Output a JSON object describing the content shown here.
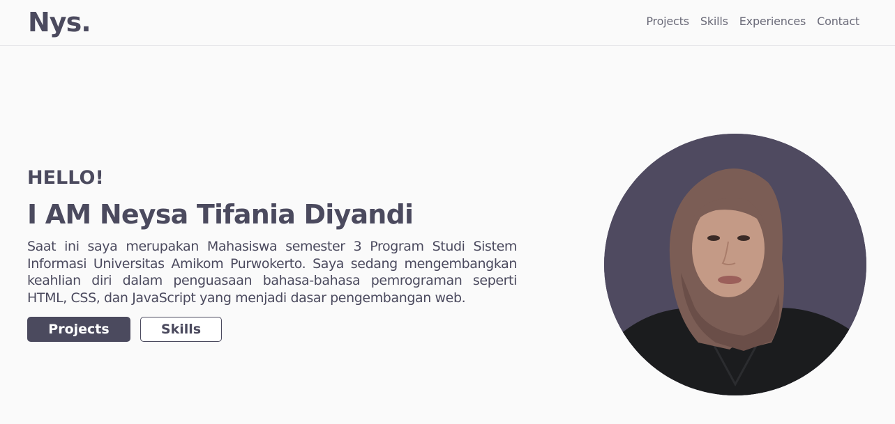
{
  "header": {
    "logo": "Nys.",
    "nav": [
      {
        "label": "Projects"
      },
      {
        "label": "Skills"
      },
      {
        "label": "Experiences"
      },
      {
        "label": "Contact"
      }
    ]
  },
  "hero": {
    "greeting": "HELLO!",
    "name": "I AM Neysa Tifania Diyandi",
    "bio": "Saat ini saya merupakan Mahasiswa semester 3 Program Studi Sistem Informasi Universitas Amikom Purwokerto. Saya sedang mengembangkan keahlian diri dalam penguasaan bahasa-bahasa pemrograman seperti HTML, CSS, dan JavaScript yang menjadi dasar pengembangan web.",
    "buttons": {
      "primary_label": "Projects",
      "secondary_label": "Skills"
    }
  },
  "colors": {
    "primary": "#4b4a5e",
    "background": "#fafafa",
    "avatar_background": "#4f4a60"
  },
  "icons": {
    "avatar": "profile-photo"
  }
}
